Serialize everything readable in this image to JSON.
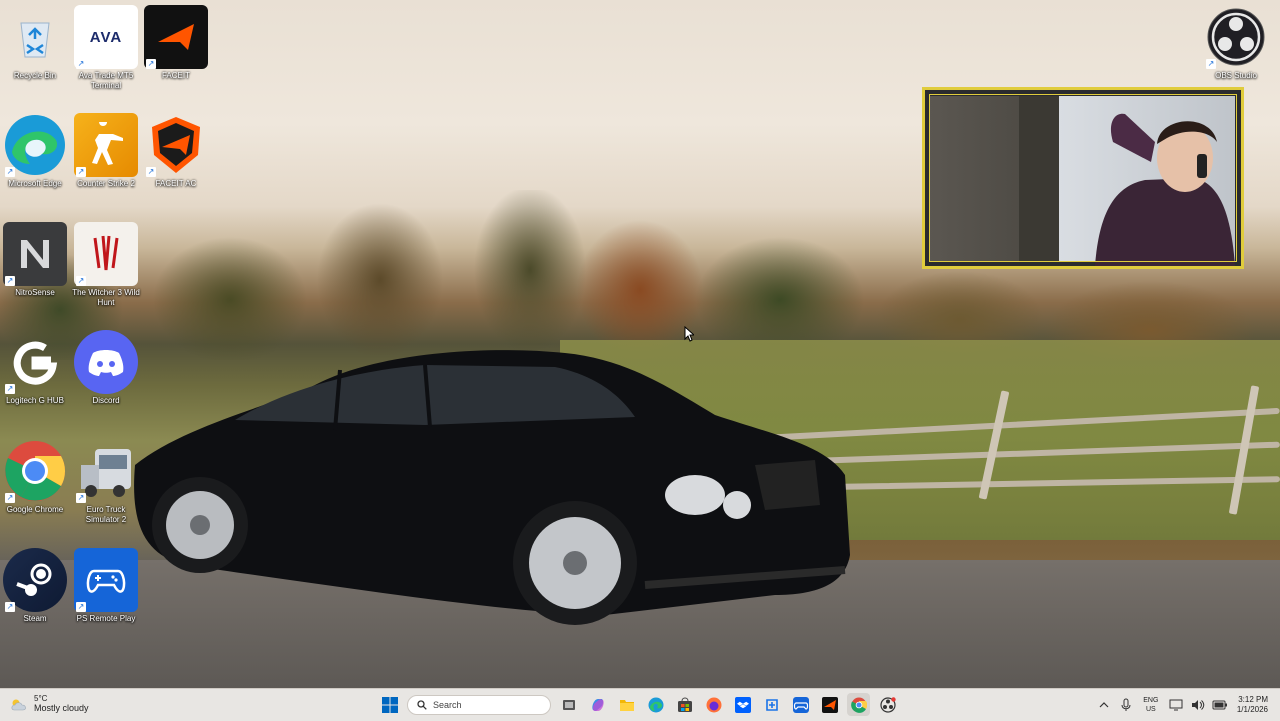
{
  "desktop": {
    "icons": [
      {
        "label": "Recycle Bin",
        "icon": "recycle-bin-icon"
      },
      {
        "label": "Ava Trade MT5 Terminal",
        "icon": "ava-trade-icon"
      },
      {
        "label": "FACEIT",
        "icon": "faceit-icon"
      },
      {
        "label": "Microsoft Edge",
        "icon": "edge-icon"
      },
      {
        "label": "Counter Strike 2",
        "icon": "counter-strike-icon"
      },
      {
        "label": "FACEIT AC",
        "icon": "faceit-ac-icon"
      },
      {
        "label": "NitroSense",
        "icon": "nitrosense-icon"
      },
      {
        "label": "The Witcher 3 Wild Hunt",
        "icon": "witcher-icon"
      },
      {
        "label": "Logitech G HUB",
        "icon": "logitech-icon"
      },
      {
        "label": "Discord",
        "icon": "discord-icon"
      },
      {
        "label": "Google Chrome",
        "icon": "chrome-icon"
      },
      {
        "label": "Euro Truck Simulator 2",
        "icon": "euro-truck-icon"
      },
      {
        "label": "Steam",
        "icon": "steam-icon"
      },
      {
        "label": "PS Remote Play",
        "icon": "ps-remote-play-icon"
      },
      {
        "label": "OBS Studio",
        "icon": "obs-icon"
      }
    ],
    "ava_logo_text": "AVA"
  },
  "taskbar": {
    "weather": {
      "temp": "5°C",
      "condition": "Mostly cloudy"
    },
    "search_placeholder": "Search",
    "language": {
      "line1": "ENG",
      "line2": "US"
    },
    "clock": {
      "time": "3:12 PM",
      "date": "1/1/2026"
    },
    "accent": "#0067c0"
  },
  "colors": {
    "webcam_border": "#e0cc3c"
  }
}
